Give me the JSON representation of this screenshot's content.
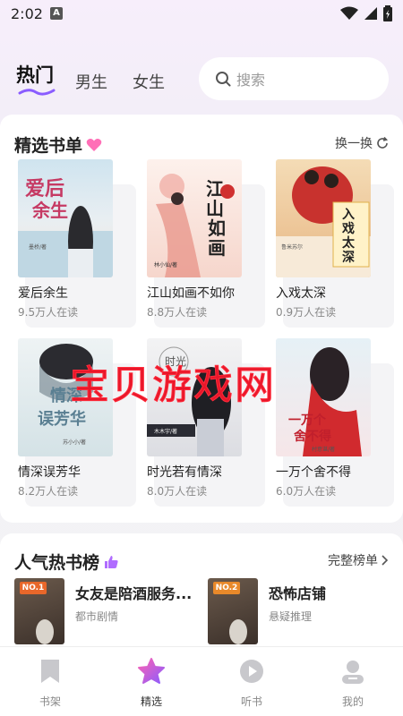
{
  "status_bar": {
    "time": "2:02",
    "notification_badge": "A"
  },
  "top_tabs": [
    {
      "label": "热门",
      "active": true
    },
    {
      "label": "男生",
      "active": false
    },
    {
      "label": "女生",
      "active": false
    }
  ],
  "search": {
    "placeholder": "搜索"
  },
  "featured": {
    "title": "精选书单",
    "refresh_label": "换一换",
    "books": [
      {
        "title": "爱后余生",
        "readers": "9.5万人在读",
        "cover_text": "爱后余生",
        "cover_colors": [
          "#cfe4ef",
          "#f4e9dd"
        ],
        "author": "墨桥/著"
      },
      {
        "title": "江山如画不如你",
        "readers": "8.8万人在读",
        "cover_text": "江山如画",
        "cover_colors": [
          "#fbe7e1",
          "#f3c9c0"
        ],
        "author": "林小仙/著"
      },
      {
        "title": "入戏太深",
        "readers": "0.9万人在读",
        "cover_text": "入戏太深",
        "cover_colors": [
          "#f1d3a6",
          "#c8322e"
        ],
        "author": "鲁米苏尔"
      },
      {
        "title": "情深误芳华",
        "readers": "8.2万人在读",
        "cover_text": "情深误芳华",
        "cover_colors": [
          "#e3ecef",
          "#cfdfe3"
        ],
        "author": "苏小小/著"
      },
      {
        "title": "时光若有情深",
        "readers": "8.0万人在读",
        "cover_text": "时光若有",
        "cover_colors": [
          "#f1f1f2",
          "#d9dbe0"
        ],
        "author": "木木宇/著"
      },
      {
        "title": "一万个舍不得",
        "readers": "6.0万人在读",
        "cover_text": "一万个舍不得",
        "cover_colors": [
          "#e8f2f6",
          "#f6e4e6"
        ],
        "author": "村意谌/著"
      }
    ]
  },
  "hot_list": {
    "title": "人气热书榜",
    "more_label": "完整榜单",
    "items": [
      {
        "rank": "NO.1",
        "title": "女友是陪酒服务...",
        "genre": "都市剧情",
        "badge_color": "#e8672a"
      },
      {
        "rank": "NO.2",
        "title": "恐怖店铺",
        "genre": "悬疑推理",
        "badge_color": "#e8892a"
      }
    ]
  },
  "watermark": "宝贝游戏网",
  "bottom_nav": [
    {
      "label": "书架",
      "icon": "bookmark-icon",
      "active": false
    },
    {
      "label": "精选",
      "icon": "star-icon",
      "active": true
    },
    {
      "label": "听书",
      "icon": "play-icon",
      "active": false
    },
    {
      "label": "我的",
      "icon": "user-icon",
      "active": false
    }
  ],
  "colors": {
    "accent_pink": "#ff5fa8",
    "accent_purple": "#7a5cff",
    "text_primary": "#222222",
    "text_secondary": "#888888"
  }
}
